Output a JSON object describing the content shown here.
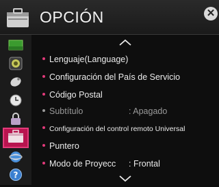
{
  "window": {
    "title": "OPCIÓN"
  },
  "close_label": "✕",
  "sidebar": {
    "items": [
      {
        "icon": "picture-icon"
      },
      {
        "icon": "sound-icon"
      },
      {
        "icon": "channel-icon"
      },
      {
        "icon": "time-icon"
      },
      {
        "icon": "lock-icon"
      },
      {
        "icon": "option-icon",
        "active": true
      },
      {
        "icon": "network-icon"
      },
      {
        "icon": "support-icon"
      }
    ]
  },
  "menu": [
    {
      "label": "Lenguaje(Language)"
    },
    {
      "label": "Configuración del País de Servicio"
    },
    {
      "label": "Código Postal"
    },
    {
      "label": "Subtítulo",
      "value": ": Apagado",
      "disabled": true
    },
    {
      "label": "Configuración del control remoto Universal"
    },
    {
      "label": "Puntero"
    },
    {
      "label": "Modo de Proyecc",
      "value": ": Frontal"
    }
  ],
  "accent_color": "#b8144f"
}
